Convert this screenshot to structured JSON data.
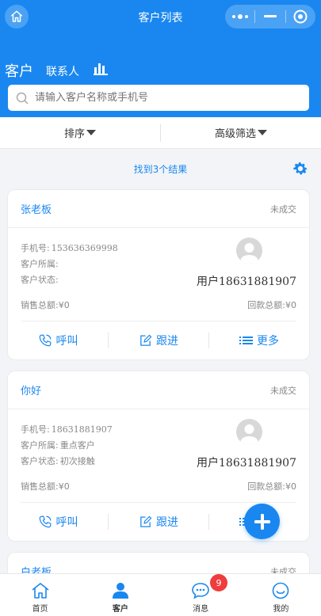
{
  "nav": {
    "title": "客户列表"
  },
  "tabs": {
    "customer": "客户",
    "contacts": "联系人"
  },
  "search": {
    "placeholder": "请输入客户名称或手机号"
  },
  "filters": {
    "sort": "排序",
    "advanced": "高级筛选"
  },
  "result_text": "找到3个结果",
  "labels": {
    "phone": "手机号:",
    "belong": "客户所属:",
    "status": "客户状态:",
    "sales": "销售总额:",
    "refund": "回款总额:",
    "call": "呼叫",
    "follow": "跟进",
    "more": "更多"
  },
  "customers": [
    {
      "name": "张老板",
      "deal_status": "未成交",
      "phone": "153636369998",
      "belong": "",
      "status": "",
      "user": "用户18631881907",
      "sales": "¥0",
      "refund": "¥0"
    },
    {
      "name": "你好",
      "deal_status": "未成交",
      "phone": "18631881907",
      "belong": "重点客户",
      "status": "初次接触",
      "user": "用户18631881907",
      "sales": "¥0",
      "refund": "¥0"
    },
    {
      "name": "白老板",
      "deal_status": "未成交"
    }
  ],
  "tabbar": [
    {
      "label": "首页",
      "icon": "home-icon"
    },
    {
      "label": "客户",
      "icon": "person-icon"
    },
    {
      "label": "消息",
      "icon": "message-icon",
      "badge": "9"
    },
    {
      "label": "我的",
      "icon": "smile-icon"
    }
  ],
  "colors": {
    "primary": "#1a87f0",
    "badge": "#f03c3c"
  }
}
